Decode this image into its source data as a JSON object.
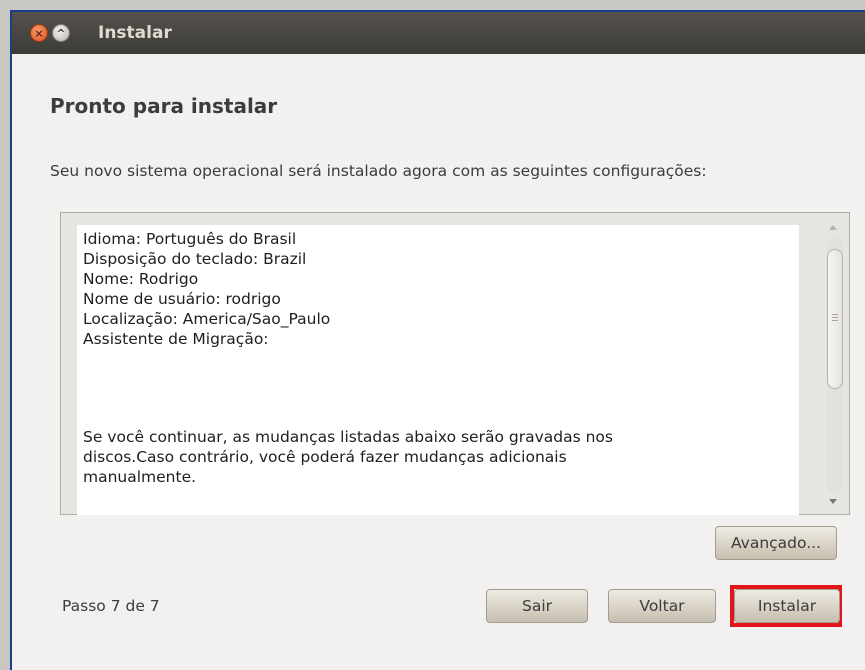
{
  "window": {
    "title": "Instalar",
    "close_glyph": "×",
    "minimize_glyph": "^"
  },
  "page": {
    "heading": "Pronto para instalar",
    "intro": "Seu novo sistema operacional será instalado agora com as seguintes configurações:"
  },
  "summary": {
    "lines": [
      "Idioma: Português do Brasil",
      "Disposição do teclado: Brazil",
      "Nome: Rodrigo",
      "Nome de usuário: rodrigo",
      "Localização: America/Sao_Paulo",
      "Assistente de Migração:"
    ],
    "notice_lines": [
      "Se você continuar, as mudanças listadas abaixo serão gravadas nos",
      "discos.Caso contrário, você poderá fazer mudanças adicionais",
      "manualmente."
    ]
  },
  "buttons": {
    "advanced": "Avançado...",
    "quit": "Sair",
    "back": "Voltar",
    "install": "Instalar"
  },
  "footer": {
    "step": "Passo 7 de 7"
  },
  "colors": {
    "highlight": "#e4141c",
    "titlebar": "#3c3b37",
    "window_border": "#1a3e8c"
  },
  "icons": {
    "close": "close-icon",
    "minimize": "minimize-icon"
  }
}
